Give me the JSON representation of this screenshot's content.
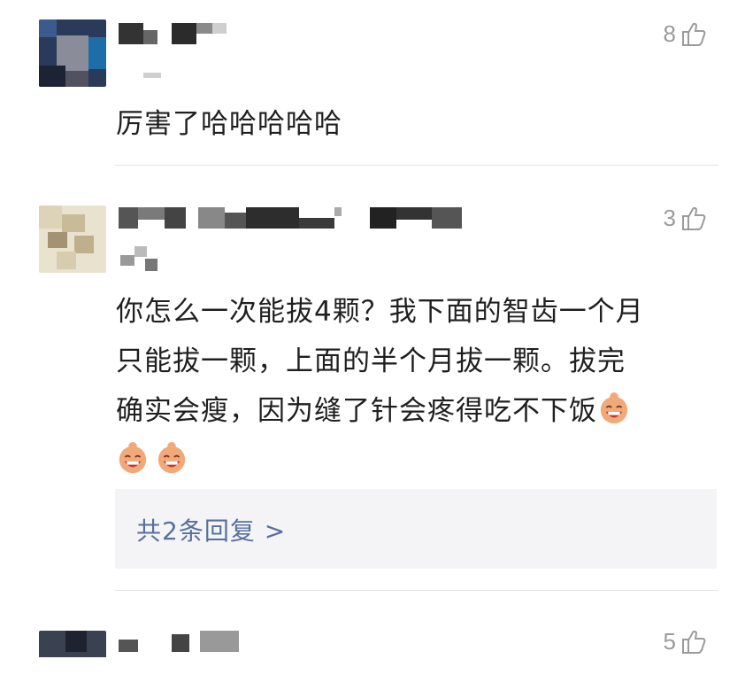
{
  "comments": [
    {
      "like_count": "8",
      "text": "厉害了哈哈哈哈哈"
    },
    {
      "like_count": "3",
      "text_lines": [
        "你怎么一次能拔4颗？我下面的智齿一个月",
        "只能拔一颗，上面的半个月拔一颗。拔完",
        "确实会瘦，因为缝了针会疼得吃不下饭"
      ],
      "emoji_icon": "laughing-face-emoji",
      "reply_link": "共2条回复 >"
    },
    {
      "like_count": "5"
    }
  ],
  "colors": {
    "like_gray": "#9b9b9b",
    "reply_link_blue": "#56709b",
    "reply_box_bg": "#f4f4f6"
  }
}
